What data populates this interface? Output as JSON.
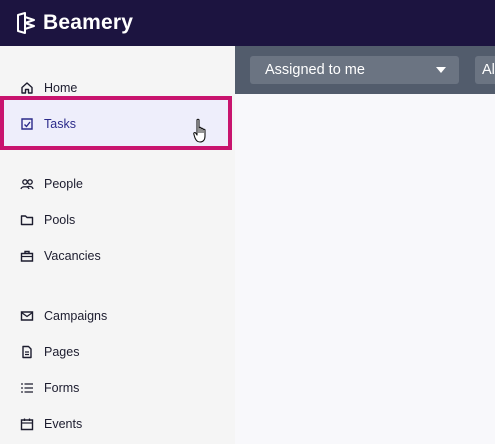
{
  "app": {
    "brand": "Beamery"
  },
  "sidebar": {
    "items": [
      {
        "key": "home",
        "label": "Home",
        "icon": "home-icon"
      },
      {
        "key": "tasks",
        "label": "Tasks",
        "icon": "tasks-icon",
        "active": true
      },
      {
        "key": "people",
        "label": "People",
        "icon": "people-icon"
      },
      {
        "key": "pools",
        "label": "Pools",
        "icon": "folder-icon"
      },
      {
        "key": "vacancies",
        "label": "Vacancies",
        "icon": "briefcase-icon"
      },
      {
        "key": "campaigns",
        "label": "Campaigns",
        "icon": "mail-icon"
      },
      {
        "key": "pages",
        "label": "Pages",
        "icon": "page-icon"
      },
      {
        "key": "forms",
        "label": "Forms",
        "icon": "list-icon"
      },
      {
        "key": "events",
        "label": "Events",
        "icon": "calendar-icon"
      }
    ]
  },
  "filters": {
    "assignee_value": "Assigned to me",
    "second_value": "Al"
  },
  "colors": {
    "topbar": "#1c1440",
    "highlight": "#c8146e",
    "filterbar": "#525c6c"
  }
}
